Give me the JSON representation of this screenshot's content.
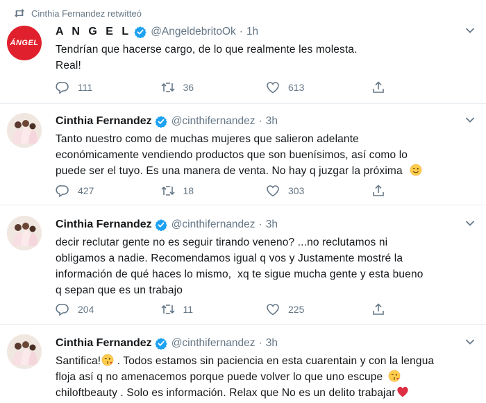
{
  "retweet_banner": {
    "text": "Cinthia Fernandez retwitteó"
  },
  "tweets": [
    {
      "avatar_label": "ÁNGEL",
      "name": "A N G E L",
      "handle": "@AngeldebritoOk",
      "time": "1h",
      "lines": [
        "Tendrían que hacerse cargo, de lo que realmente les molesta.",
        "Real!"
      ],
      "replies": "111",
      "retweets": "36",
      "likes": "613"
    },
    {
      "name": "Cinthia Fernandez",
      "handle": "@cinthifernandez",
      "time": "3h",
      "lines": [
        "Tanto nuestro como de muchas mujeres que salieron adelante",
        "económicamente vendiendo productos que son buenísimos, así como lo",
        "puede ser el tuyo. Es una manera de venta. No hay q juzgar la próxima"
      ],
      "replies": "427",
      "retweets": "18",
      "likes": "303"
    },
    {
      "name": "Cinthia Fernandez",
      "handle": "@cinthifernandez",
      "time": "3h",
      "lines": [
        "decir reclutar gente no es seguir tirando veneno? ...no reclutamos ni",
        "obligamos a nadie. Recomendamos igual q vos y Justamente mostré la",
        "información de qué haces lo mismo,  xq te sigue mucha gente y esta bueno",
        "q sepan que es un trabajo"
      ],
      "replies": "204",
      "retweets": "11",
      "likes": "225"
    },
    {
      "name": "Cinthia Fernandez",
      "handle": "@cinthifernandez",
      "time": "3h",
      "line1_a": "Santifica!",
      "line1_b": " . Todos estamos sin paciencia en esta cuarentain y con la lengua",
      "line2": "floja así q no amenacemos porque puede volver lo que uno escupe",
      "line3": "chiloftbeauty . Solo es información. Relax que No es un delito trabajar"
    }
  ],
  "dot": "·",
  "colors": {
    "verified": "#1da1f2",
    "muted": "#657786",
    "angel_red": "#e0202c"
  },
  "icons": [
    "retweet-icon",
    "verified-badge-icon",
    "chevron-down-icon",
    "reply-icon",
    "like-icon",
    "share-icon",
    "wink-emoji-icon",
    "kiss-emoji-icon",
    "heart-emoji-icon"
  ]
}
